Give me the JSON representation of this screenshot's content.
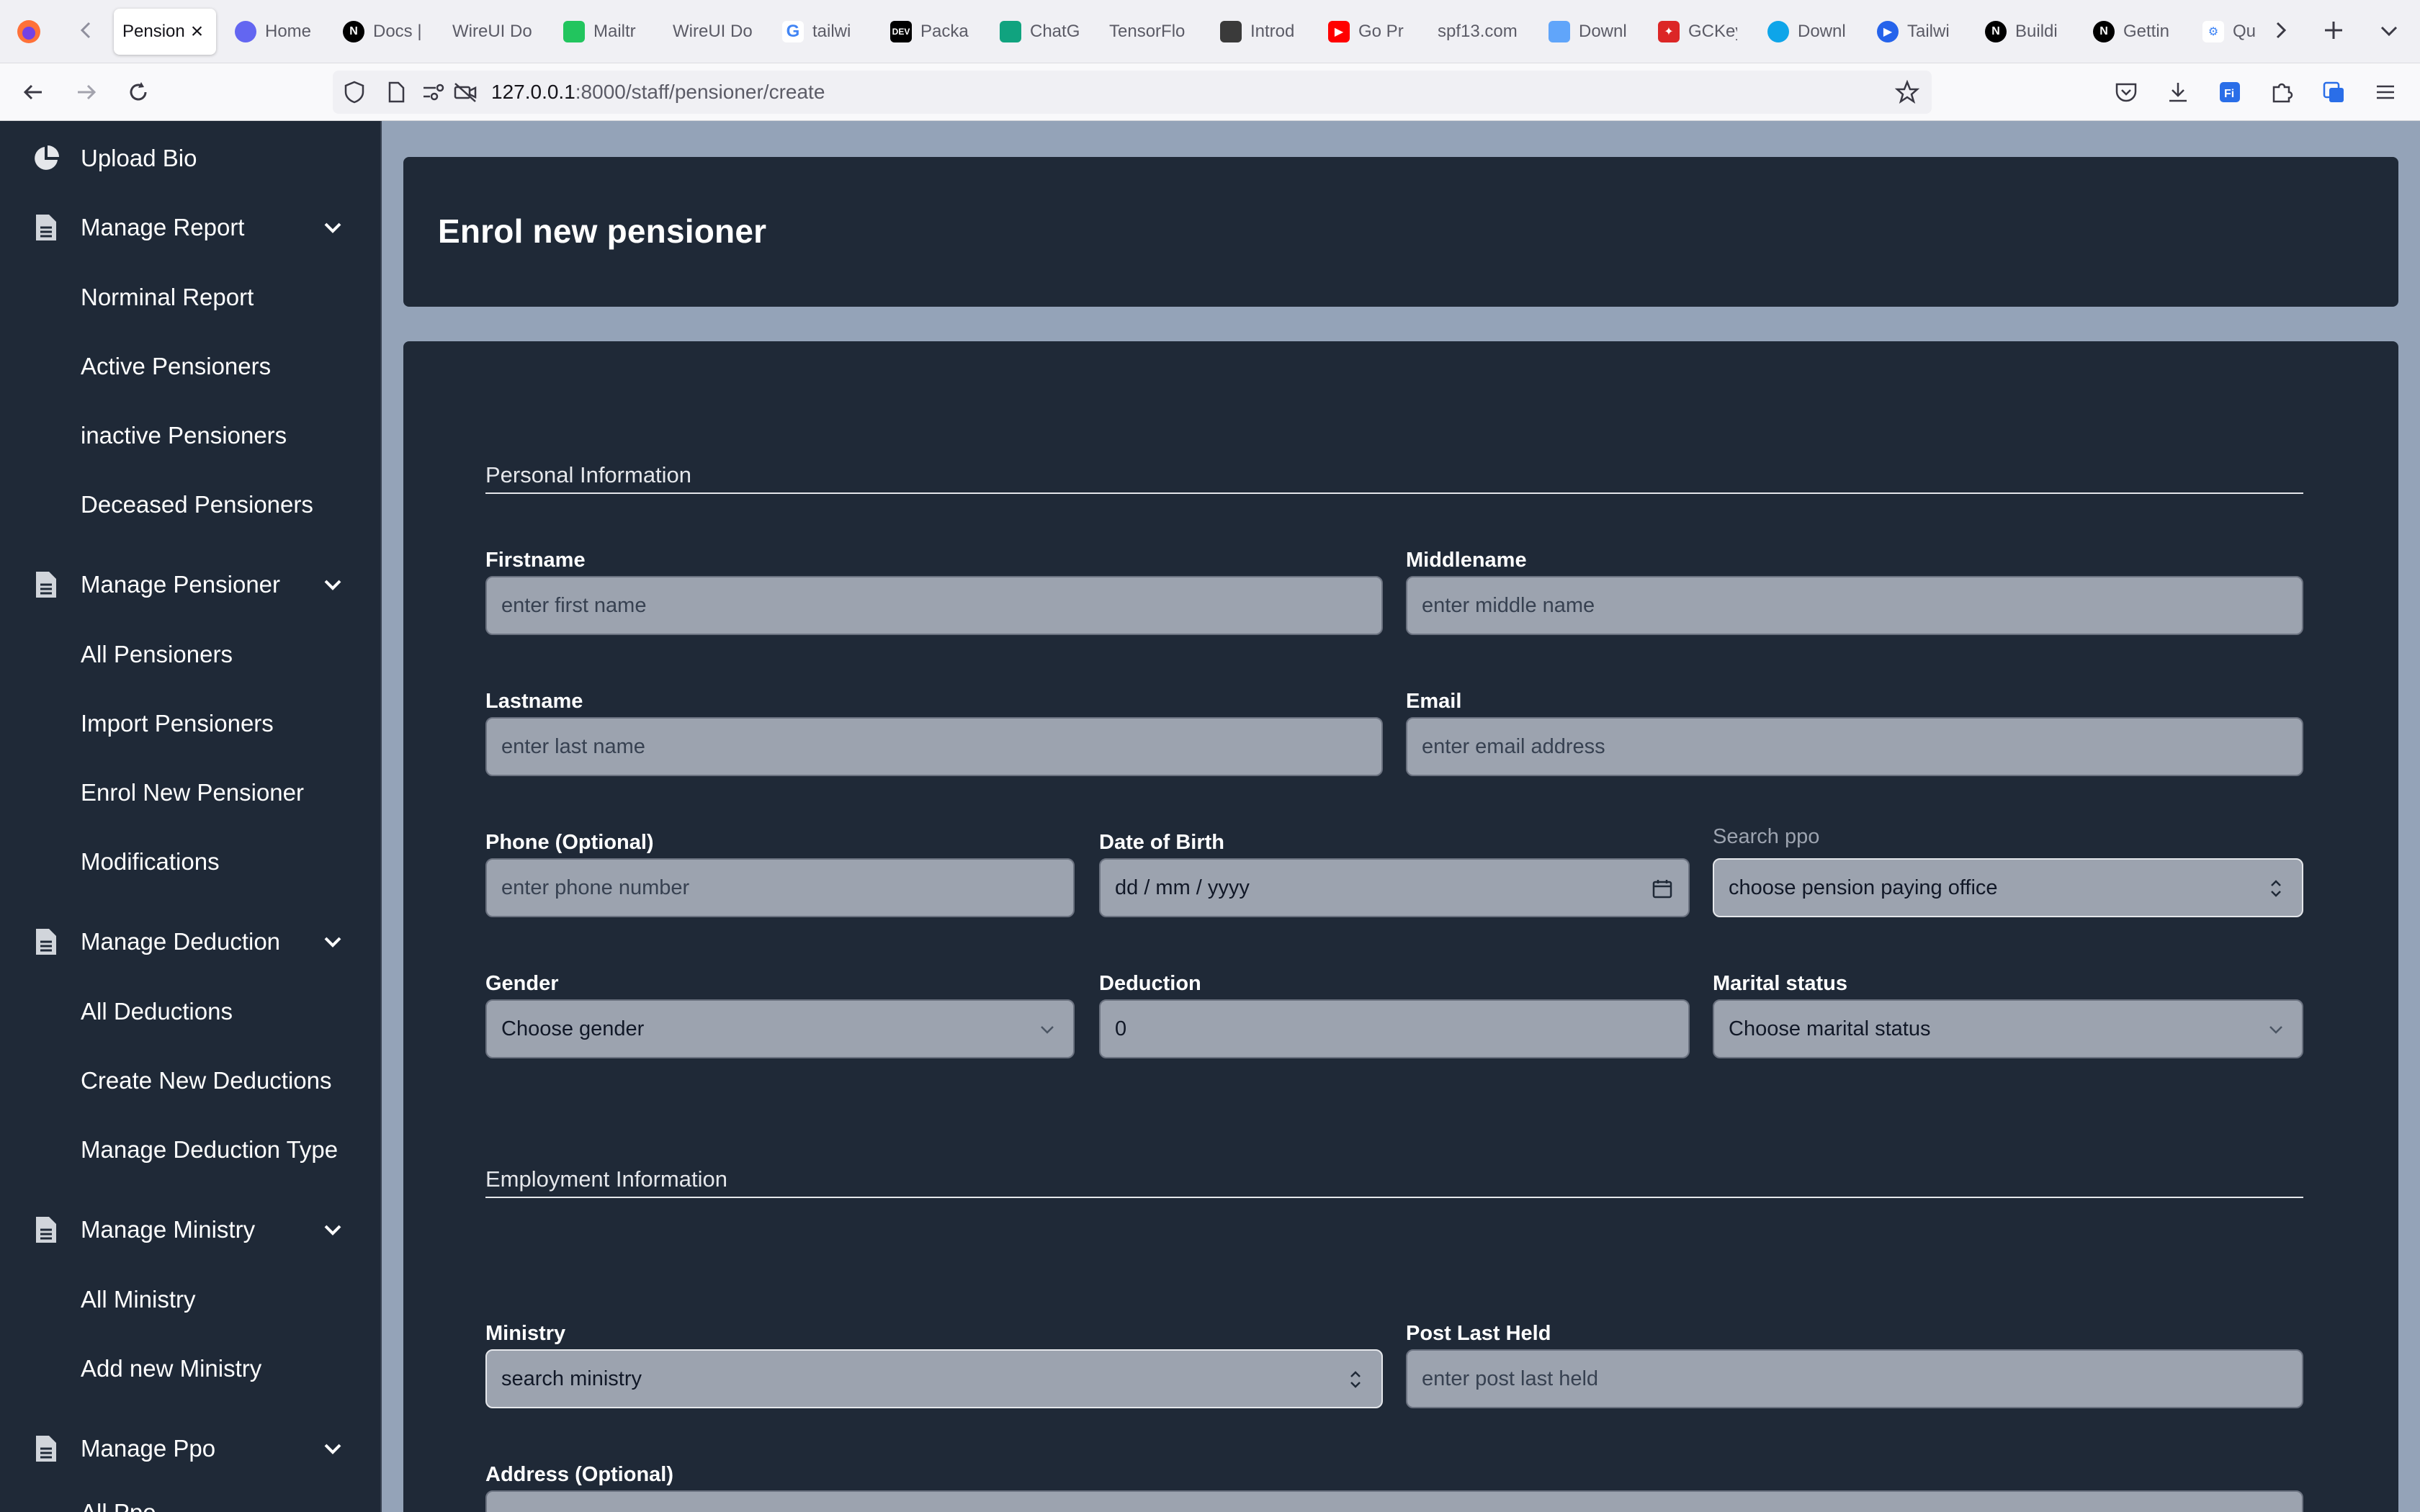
{
  "browser": {
    "tabs": [
      {
        "label": "Pension",
        "active": true
      },
      {
        "label": "Home"
      },
      {
        "label": "Docs |"
      },
      {
        "label": "WireUI Do"
      },
      {
        "label": "Mailtr"
      },
      {
        "label": "WireUI Do"
      },
      {
        "label": "tailwi"
      },
      {
        "label": "Packa"
      },
      {
        "label": "ChatG"
      },
      {
        "label": "TensorFlo"
      },
      {
        "label": "Introd"
      },
      {
        "label": "Go Pr"
      },
      {
        "label": "spf13.com"
      },
      {
        "label": "Downl"
      },
      {
        "label": "GCKey"
      },
      {
        "label": "Downl"
      },
      {
        "label": "Tailwi"
      },
      {
        "label": "Buildi"
      },
      {
        "label": "Gettin"
      },
      {
        "label": "Qu"
      }
    ],
    "url_host": "127.0.0.1",
    "url_path": ":8000/staff/pensioner/create"
  },
  "sidebar": {
    "upload_bio": "Upload Bio",
    "groups": [
      {
        "label": "Manage Report",
        "items": [
          "Norminal Report",
          "Active Pensioners",
          "inactive Pensioners",
          "Deceased Pensioners"
        ]
      },
      {
        "label": "Manage Pensioner",
        "items": [
          "All Pensioners",
          "Import Pensioners",
          "Enrol New Pensioner",
          "Modifications"
        ]
      },
      {
        "label": "Manage Deduction",
        "items": [
          "All Deductions",
          "Create New Deductions",
          "Manage Deduction Type"
        ]
      },
      {
        "label": "Manage Ministry",
        "items": [
          "All Ministry",
          "Add new Ministry"
        ]
      },
      {
        "label": "Manage Ppo",
        "items": [
          "All Ppo"
        ]
      }
    ]
  },
  "page": {
    "title": "Enrol new pensioner"
  },
  "form": {
    "personal_title": "Personal Information",
    "employment_title": "Employment Information",
    "firstname": {
      "label": "Firstname",
      "placeholder": "enter first name"
    },
    "middlename": {
      "label": "Middlename",
      "placeholder": "enter middle name"
    },
    "lastname": {
      "label": "Lastname",
      "placeholder": "enter last name"
    },
    "email": {
      "label": "Email",
      "placeholder": "enter email address"
    },
    "phone": {
      "label": "Phone (Optional)",
      "placeholder": "enter phone number"
    },
    "dob": {
      "label": "Date of Birth",
      "value": "dd / mm / yyyy"
    },
    "ppo": {
      "label": "Search ppo",
      "value": "choose pension paying office"
    },
    "gender": {
      "label": "Gender",
      "value": "Choose gender"
    },
    "deduction": {
      "label": "Deduction",
      "value": "0"
    },
    "marital": {
      "label": "Marital status",
      "value": "Choose marital status"
    },
    "ministry": {
      "label": "Ministry",
      "value": "search ministry"
    },
    "post": {
      "label": "Post Last Held",
      "placeholder": "enter post last held"
    },
    "address": {
      "label": "Address (Optional)"
    }
  },
  "colors": {
    "sidebar_bg": "#1f2937",
    "main_bg": "#94a3b8",
    "input_bg": "#9ca3af"
  }
}
